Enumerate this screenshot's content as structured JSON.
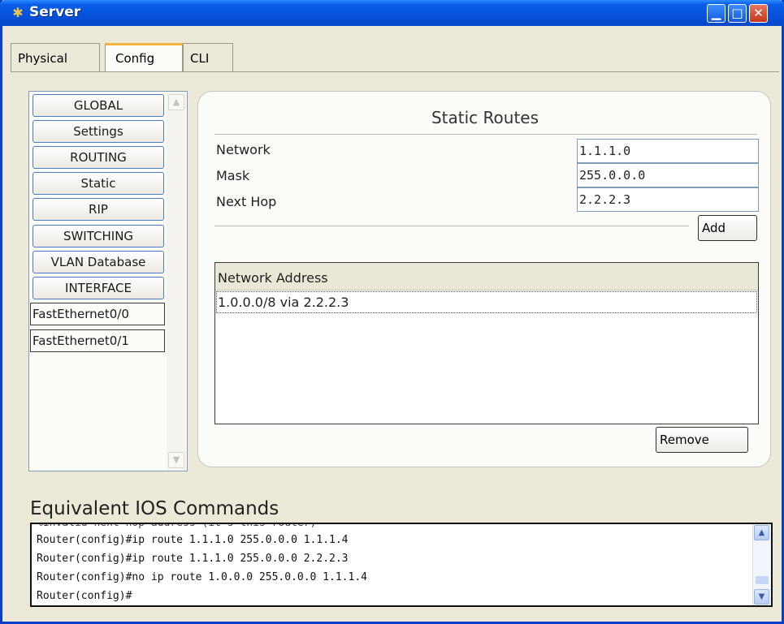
{
  "window": {
    "title": "Server",
    "icons": {
      "app": "server-icon",
      "minimize": "minimize-icon",
      "maximize": "maximize-icon",
      "close": "close-icon"
    }
  },
  "tabs": [
    {
      "label": "Physical"
    },
    {
      "label": "Config"
    },
    {
      "label": "CLI"
    }
  ],
  "sidebar": {
    "items": [
      {
        "label": "GLOBAL"
      },
      {
        "label": "Settings"
      },
      {
        "label": "ROUTING"
      },
      {
        "label": "Static"
      },
      {
        "label": "RIP"
      },
      {
        "label": "SWITCHING"
      },
      {
        "label": "VLAN Database"
      },
      {
        "label": "INTERFACE"
      },
      {
        "label": "FastEthernet0/0"
      },
      {
        "label": "FastEthernet0/1"
      }
    ]
  },
  "static_routes": {
    "title": "Static Routes",
    "network_label": "Network",
    "network_value": "1.1.1.0",
    "mask_label": "Mask",
    "mask_value": "255.0.0.0",
    "next_hop_label": "Next Hop",
    "next_hop_value": "2.2.2.3",
    "add_label": "Add",
    "table_header": "Network Address",
    "routes": [
      "1.0.0.0/8 via 2.2.2.3"
    ],
    "remove_label": "Remove"
  },
  "ios": {
    "title": "Equivalent IOS Commands",
    "cut_line": "%Invalid next hop address (it's this router)",
    "lines": [
      "Router(config)#ip route 1.1.1.0 255.0.0.0 1.1.1.4",
      "Router(config)#ip route 1.1.1.0 255.0.0.0 2.2.2.3",
      "Router(config)#no ip route 1.0.0.0 255.0.0.0 1.1.1.4",
      "Router(config)#"
    ]
  },
  "colors": {
    "title_bar": "#0551dc",
    "active_tab_accent": "#f4b33b",
    "panel_bg": "#ece9d8"
  }
}
